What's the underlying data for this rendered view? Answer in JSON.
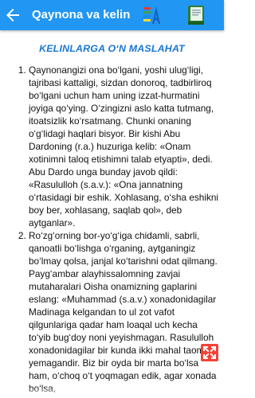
{
  "appbar": {
    "title": "Qaynona va kelin",
    "back_icon": "arrow-back-icon",
    "font_icon": "font-size-icon",
    "book_icon": "book-icon",
    "colors": {
      "bar": "#2196F3"
    }
  },
  "article": {
    "heading": "KELINLARGA O‘N MASLAHAT",
    "items": [
      {
        "text": "Qaynonangizi ona bo‘lgani, yoshi ulug‘ligi, tajribasi kattaligi, sizdan donoroq, tadbirliroq bo‘lgani uchun ham uning izzat-hurmatini joyiga qo‘ying. O‘zingizni aslo katta tutmang, itoatsizlik ko‘rsatmang. Chunki onaning o‘g‘lidagi haqlari bisyor. Bir kishi Abu Dardoning (r.a.) huzuriga kelib: «Onam xotinimni taloq etishimni talab etyapti», dedi. Abu Dardo unga bunday javob qildi: «Rasululloh (s.a.v.): «Ona jannatning o‘rtasidagi bir eshik. Xohlasang, o‘sha eshikni boy ber, xohlasang, saqlab qol», deb aytganlar»."
      },
      {
        "text": "Ro‘zg‘orning bor-yo‘g‘iga chidamli, sabrli, qanoatli bo‘lishga o‘rganing, aytganingiz bo‘lmay qolsa, janjal ko‘tarishni odat qilmang. Payg‘ambar alayhissalomning zavjai mutaharalari Oisha onamizning gaplarini eslang: «Muhammad (s.a.v.) xonadonidagilar Madinaga kelgandan to ul zot vafot qilgunlariga qadar ham loaqal uch kecha to‘yib bug‘doy noni yeyishmagan. Rasululloh xonadonidagilar bir kunda ikki mahal taom yemagandir. Biz bir oyda bir marta bo‘lsa ham, o‘choq o‘t yoqmagan edik, agar xonada bo‘lsa,"
      }
    ]
  },
  "fab": {
    "icon": "fullscreen-icon",
    "color": "#F44336"
  }
}
